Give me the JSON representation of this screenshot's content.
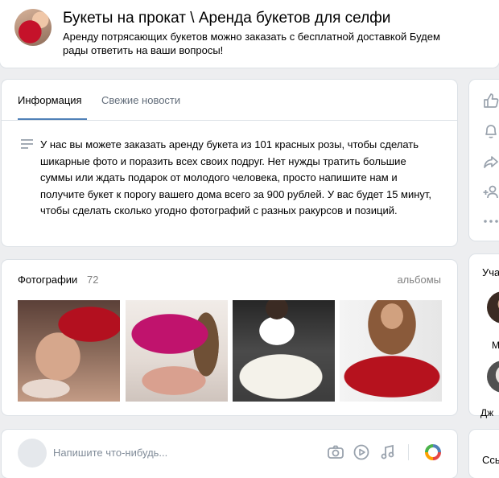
{
  "header": {
    "title": "Букеты на прокат \\ Аренда букетов для селфи",
    "subtitle": "Аренду потрясающих букетов можно заказать с бесплатной доставкой Будем рады ответить на ваши вопросы!"
  },
  "tabs": [
    {
      "label": "Информация",
      "active": true
    },
    {
      "label": "Свежие новости",
      "active": false
    }
  ],
  "description": "У нас вы можете заказать аренду букета из 101 красных розы, чтобы сделать шикарные фото и поразить всех своих подруг. Нет нужды тратить большие суммы или ждать подарок от молодого человека, просто напишите нам и получите букет к порогу вашего дома всего за 900 рублей. У вас будет 15 минут, чтобы сделать сколько угодно фотографий с разных ракурсов и позиций.",
  "photos": {
    "title": "Фотографии",
    "count": "72",
    "albums_link": "альбомы"
  },
  "post": {
    "placeholder": "Напишите что-нибудь..."
  },
  "side_actions": {
    "icons": [
      "like-icon",
      "bell-icon",
      "share-icon",
      "add-friend-icon",
      "more-icon"
    ]
  },
  "members": {
    "heading": "Уча",
    "names": [
      "М",
      "Дж"
    ]
  },
  "docs": {
    "heading": "Ссы"
  },
  "colors": {
    "background": "#edeef0",
    "accent": "#5181b8",
    "muted": "#828282",
    "icon": "#99a2ad"
  }
}
